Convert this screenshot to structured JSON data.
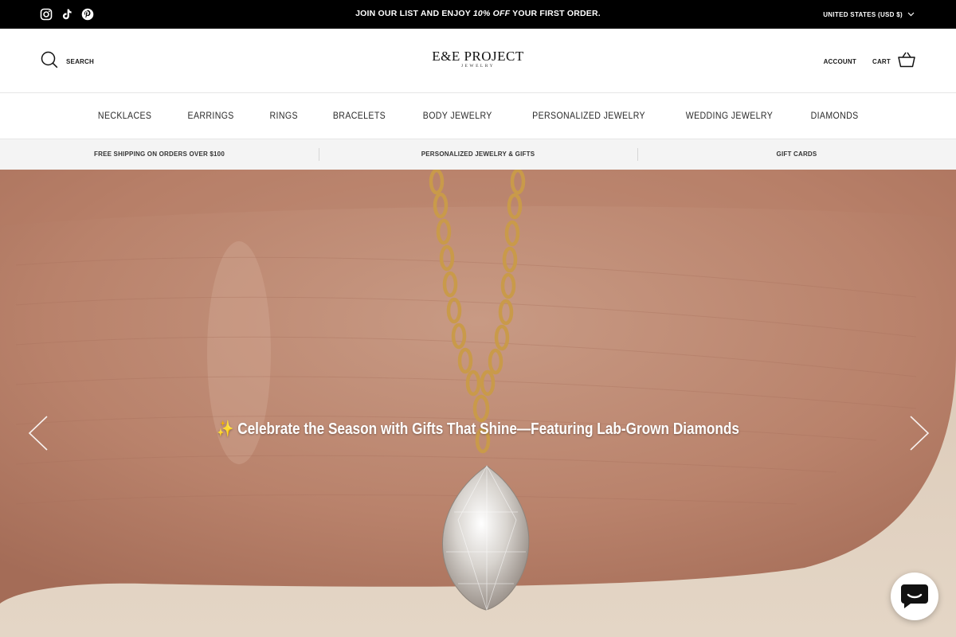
{
  "announcement": {
    "text_before": "JOIN OUR LIST AND ENJOY ",
    "text_emphasis": "10% OFF",
    "text_after": " YOUR FIRST ORDER.",
    "currency": "UNITED STATES (USD $)",
    "social_icons": [
      "instagram-icon",
      "tiktok-icon",
      "pinterest-icon"
    ]
  },
  "header": {
    "search_label": "SEARCH",
    "logo_main": "E&E PROJECT",
    "logo_sub": "JEWELRY",
    "account_label": "ACCOUNT",
    "cart_label": "CART"
  },
  "nav": {
    "items": [
      {
        "label": "NECKLACES"
      },
      {
        "label": "EARRINGS"
      },
      {
        "label": "RINGS"
      },
      {
        "label": "BRACELETS"
      },
      {
        "label": "BODY JEWELRY"
      },
      {
        "label": "PERSONALIZED JEWELRY"
      },
      {
        "label": "WEDDING JEWELRY"
      },
      {
        "label": "DIAMONDS"
      }
    ]
  },
  "promo": {
    "items": [
      {
        "label": "FREE SHIPPING ON ORDERS OVER $100"
      },
      {
        "label": "PERSONALIZED JEWELRY & GIFTS"
      },
      {
        "label": "GIFT CARDS"
      }
    ]
  },
  "hero": {
    "caption": "✨ Celebrate the Season with Gifts That Shine—Featuring Lab-Grown Diamonds"
  },
  "colors": {
    "announcement_bg": "#000000",
    "promo_bg": "#f4f4f4",
    "hero_skin": "#c08e76",
    "chain_gold": "#c99a4a"
  }
}
